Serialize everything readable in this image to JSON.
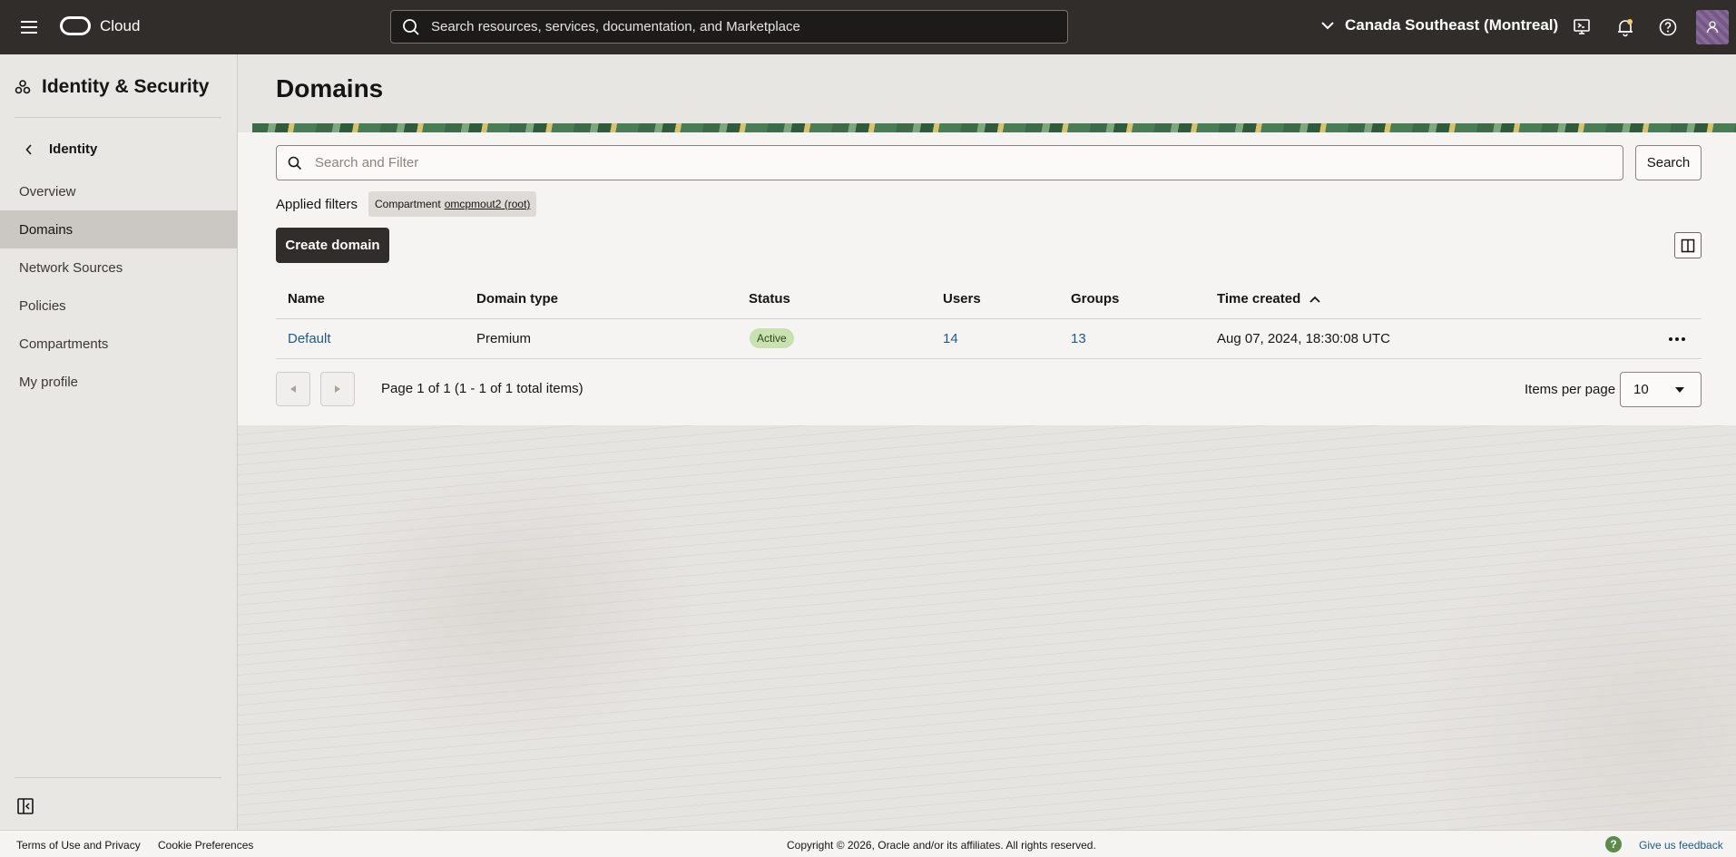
{
  "header": {
    "brand": "Cloud",
    "search_placeholder": "Search resources, services, documentation, and Marketplace",
    "region": "Canada Southeast (Montreal)",
    "icons": [
      "menu-icon",
      "cloud-shell-icon",
      "notifications-icon",
      "help-icon",
      "user-icon"
    ]
  },
  "sidebar": {
    "title": "Identity & Security",
    "back_label": "Identity",
    "items": [
      {
        "label": "Overview"
      },
      {
        "label": "Domains",
        "active": true
      },
      {
        "label": "Network Sources"
      },
      {
        "label": "Policies"
      },
      {
        "label": "Compartments"
      },
      {
        "label": "My profile"
      }
    ]
  },
  "main": {
    "title": "Domains",
    "filter_placeholder": "Search and Filter",
    "search_button": "Search",
    "applied_filters_label": "Applied filters",
    "filter_chip": {
      "prefix": "Compartment",
      "value": "omcpmout2 (root)"
    },
    "create_button": "Create domain",
    "table": {
      "columns": [
        "Name",
        "Domain type",
        "Status",
        "Users",
        "Groups",
        "Time created"
      ],
      "sort_column": "Time created",
      "sort_direction": "ascending",
      "rows": [
        {
          "name": "Default",
          "type": "Premium",
          "status": "Active",
          "users": "14",
          "groups": "13",
          "created": "Aug 07, 2024, 18:30:08 UTC"
        }
      ]
    },
    "pagination": {
      "text": "Page 1 of 1 (1 - 1 of 1 total items)",
      "items_per_page_label": "Items per page",
      "items_per_page": "10"
    }
  },
  "footer": {
    "terms": "Terms of Use and Privacy",
    "cookies": "Cookie Preferences",
    "copyright": "Copyright © 2026, Oracle and/or its affiliates. All rights reserved.",
    "feedback": "Give us feedback"
  },
  "colors": {
    "topbar": "#312d2a",
    "link": "#1e5a8a",
    "status_active_bg": "#c9e0b0",
    "sidebar_active": "#cbc7c2"
  }
}
